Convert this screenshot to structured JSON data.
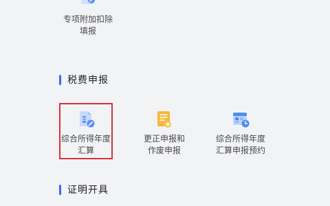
{
  "top_item": {
    "label": "专项附加扣除\n填报",
    "icon": "document-edit-icon"
  },
  "sections": {
    "tax_filing": {
      "title": "税费申报"
    },
    "certificate": {
      "title": "证明开具"
    }
  },
  "tax_items": [
    {
      "label": "综合所得年度\n汇算",
      "icon": "document-edit-icon",
      "color": "#5b8ff9"
    },
    {
      "label": "更正申报和\n作废申报",
      "icon": "yellow-document-icon",
      "color": "#f5b83d"
    },
    {
      "label": "综合所得年度\n汇算申报预约",
      "icon": "calendar-clock-icon",
      "color": "#4c8df6"
    }
  ],
  "colors": {
    "accent": "#2f6cf6",
    "highlight": "#d9303a",
    "background": "#f2f3f5"
  }
}
